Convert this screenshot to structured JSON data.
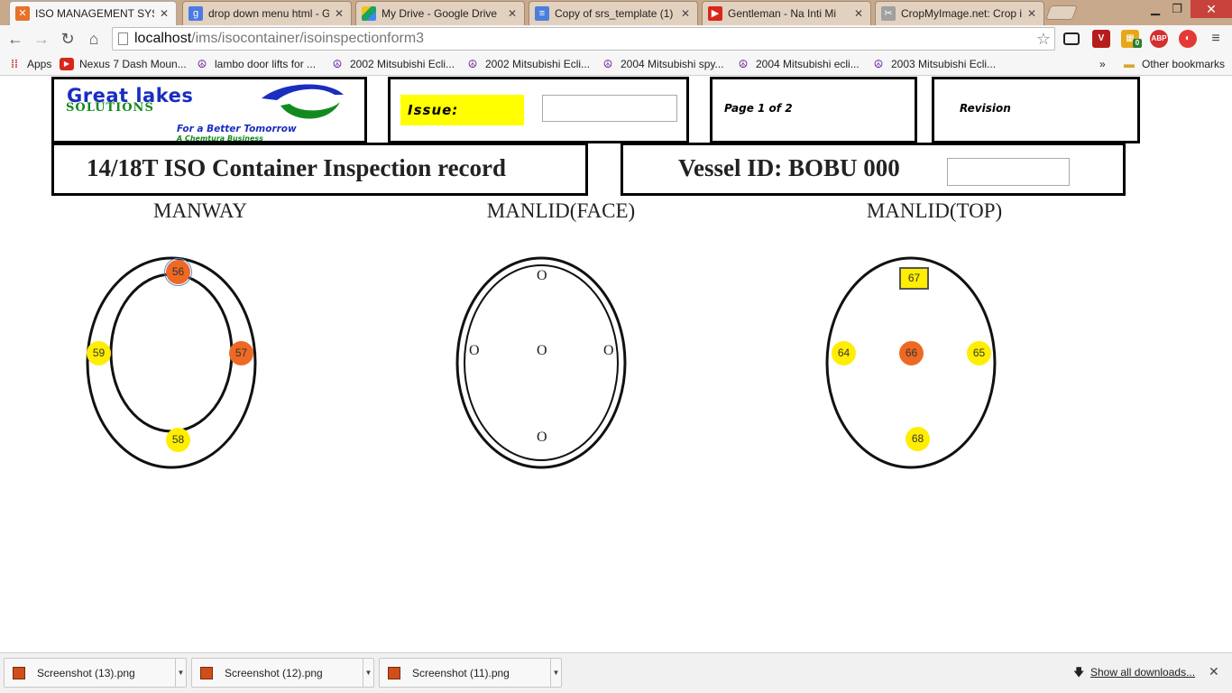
{
  "browser": {
    "tabs": [
      {
        "label": "ISO MANAGEMENT SYSTE",
        "icon": "xampp-icon"
      },
      {
        "label": "drop down menu html - G",
        "icon": "google-icon"
      },
      {
        "label": "My Drive - Google Drive",
        "icon": "drive-icon"
      },
      {
        "label": "Copy of srs_template (1) -",
        "icon": "docs-icon"
      },
      {
        "label": "Gentleman - Na Inti Mi",
        "icon": "youtube-icon"
      },
      {
        "label": "CropMyImage.net: Crop i",
        "icon": "crop-icon"
      }
    ],
    "url_host": "localhost",
    "url_path": "/ims/isocontainer/isoinspectionform3",
    "bookmarks": [
      {
        "label": "Apps"
      },
      {
        "label": "Nexus 7 Dash Moun..."
      },
      {
        "label": "lambo door lifts for ..."
      },
      {
        "label": "2002 Mitsubishi Ecli..."
      },
      {
        "label": "2002 Mitsubishi Ecli..."
      },
      {
        "label": "2004 Mitsubishi spy..."
      },
      {
        "label": "2004 Mitsubishi ecli..."
      },
      {
        "label": "2003 Mitsubishi Ecli..."
      }
    ],
    "bookmarks_overflow": "»",
    "other_bookmarks": "Other bookmarks",
    "extensions": {
      "abp": "ABP",
      "badge": "0"
    }
  },
  "header": {
    "logo": {
      "line1": "Great lakes",
      "line2": "SOLUTIONS",
      "tagline": "For a Better Tomorrow",
      "subtitle": "A Chemtura Business"
    },
    "issue_label": "Issue:",
    "issue_value": "",
    "page_label": "Page 1 of 2",
    "revision_label": "Revision",
    "form_title": "14/18T ISO Container Inspection record",
    "vessel_label": "Vessel ID: BOBU 000",
    "vessel_value": ""
  },
  "diagrams": {
    "manway": {
      "title": "MANWAY",
      "markers": {
        "top": "56",
        "right": "57",
        "bottom": "58",
        "left": "59"
      }
    },
    "manlid_face": {
      "title": "MANLID(FACE)",
      "points": {
        "top": "O",
        "left": "O",
        "center": "O",
        "right": "O",
        "bottom": "O"
      }
    },
    "manlid_top": {
      "title": "MANLID(TOP)",
      "markers": {
        "top": "67",
        "left": "64",
        "center": "66",
        "right": "65",
        "bottom": "68"
      }
    },
    "colors": {
      "orange": "#ee6a24",
      "yellow": "#ffee00"
    }
  },
  "downloads": {
    "items": [
      {
        "name": "Screenshot (13).png"
      },
      {
        "name": "Screenshot (12).png"
      },
      {
        "name": "Screenshot (11).png"
      }
    ],
    "show_all": "Show all downloads..."
  }
}
